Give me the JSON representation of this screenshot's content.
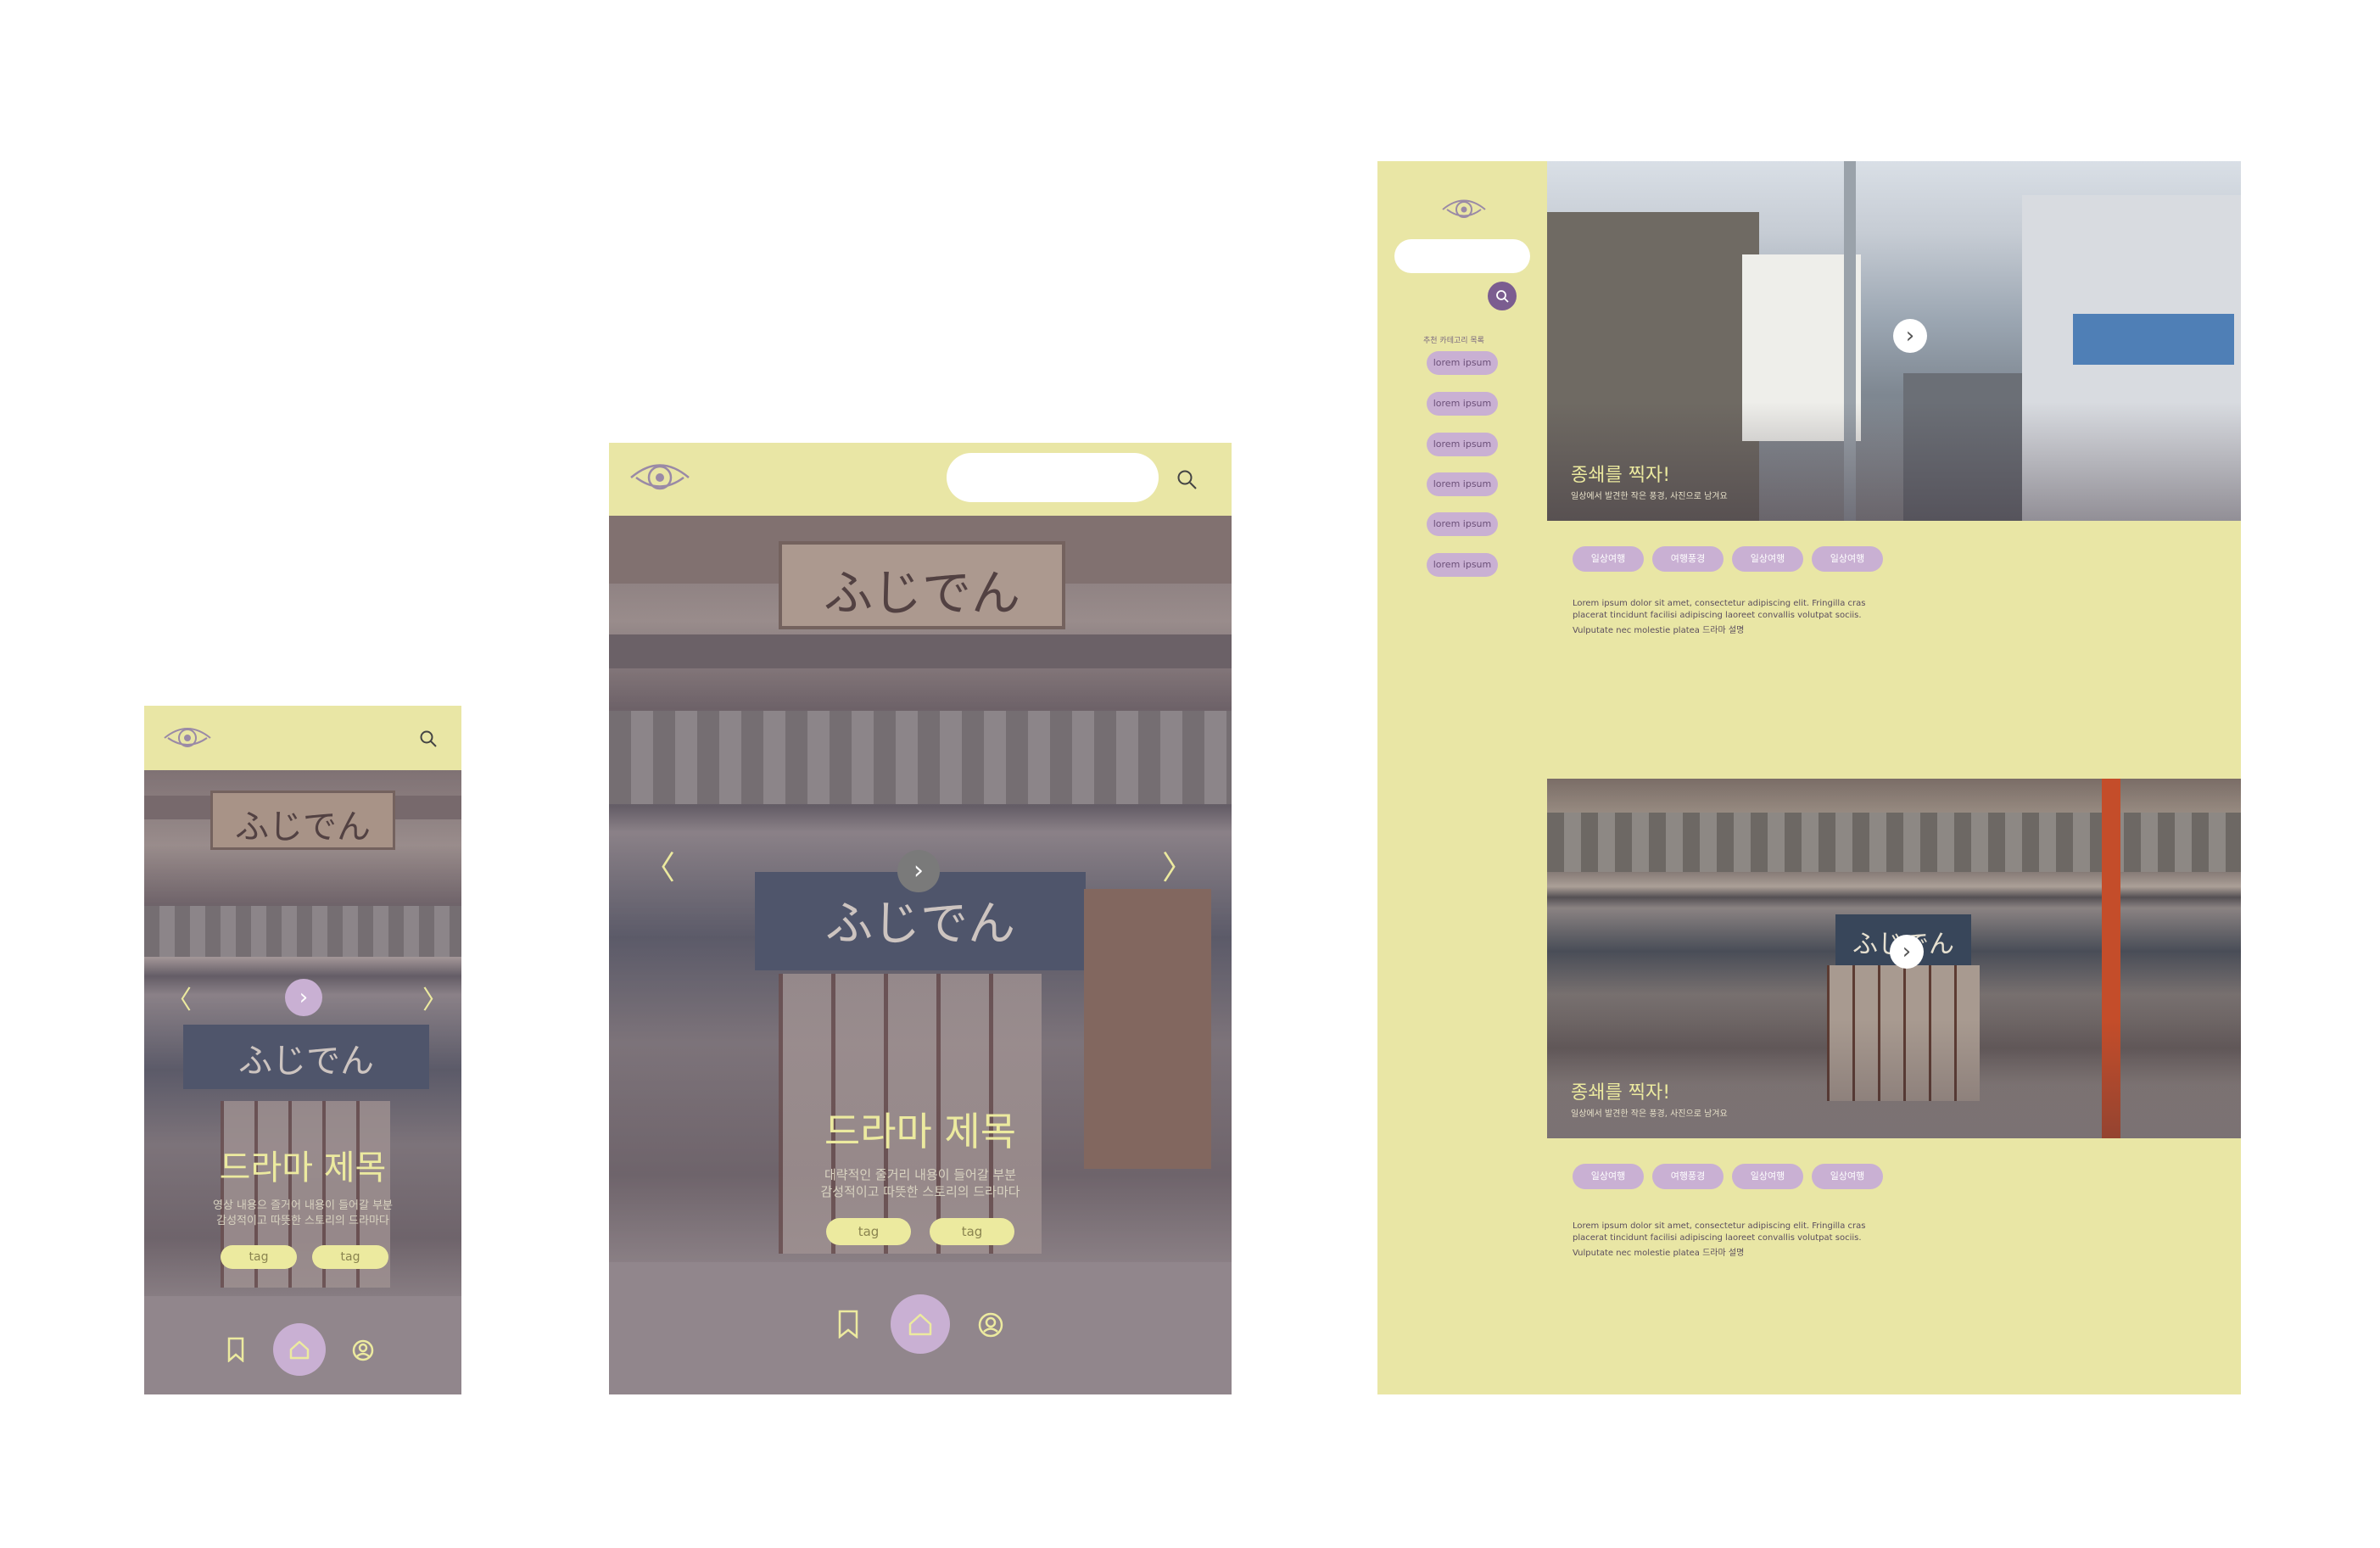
{
  "colors": {
    "yellow": "#e9e6a5",
    "lilac": "#c9b0d3",
    "purple": "#7b5d90",
    "cream": "#ecea9f"
  },
  "icons": [
    "eye-logo-icon",
    "search-icon",
    "bookmark-icon",
    "home-icon",
    "profile-icon",
    "chevron-right-icon",
    "chevron-left-icon"
  ],
  "mobile": {
    "title": "드라마 제목",
    "subtitle_lines": [
      "영상 내용으 즐거어 내용이 들어갈 부분",
      "감성적이고 따뜻한 스토리의 드라마다"
    ],
    "tags": [
      "tag",
      "tag"
    ],
    "shop_sign": "ふじでん",
    "noren_sign": "ふじでん"
  },
  "tablet": {
    "title": "드라마 제목",
    "subtitle_lines": [
      "대략적인 줄거리 내용이 들어갈 부분",
      "감성적이고 따뜻한 스토리의 드라마다"
    ],
    "tags": [
      "tag",
      "tag"
    ],
    "shop_sign": "ふじでん",
    "noren_sign": "ふじでん"
  },
  "desktop": {
    "sidebar_heading": "추천 카테고리 목록",
    "sidebar_items": [
      "lorem ipsum",
      "lorem ipsum",
      "lorem ipsum",
      "lorem ipsum",
      "lorem ipsum",
      "lorem ipsum"
    ],
    "cards": [
      {
        "title": "종쇄를 찍자!",
        "caption": "일상에서 발견한 작은 풍경, 사진으로 남겨요",
        "chips": [
          "일상여행",
          "여행풍경",
          "일상여행",
          "일상여행"
        ],
        "body": [
          "Lorem ipsum dolor sit amet, consectetur adipiscing elit. Fringilla cras",
          "placerat tincidunt facilisi adipiscing laoreet convallis volutpat sociis.",
          "Vulputate nec molestie platea 드라마 설명"
        ]
      },
      {
        "title": "종쇄를 찍자!",
        "caption": "일상에서 발견한 작은 풍경, 사진으로 남겨요",
        "chips": [
          "일상여행",
          "여행풍경",
          "일상여행",
          "일상여행"
        ],
        "body": [
          "Lorem ipsum dolor sit amet, consectetur adipiscing elit. Fringilla cras",
          "placerat tincidunt facilisi adipiscing laoreet convallis volutpat sociis.",
          "Vulputate nec molestie platea 드라마 설명"
        ]
      }
    ],
    "store_sign": "ふじでん"
  }
}
